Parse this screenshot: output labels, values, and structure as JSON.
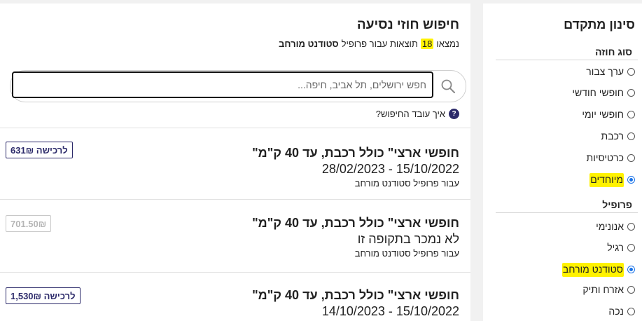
{
  "results": {
    "title": "חיפוש חוזי נסיעה",
    "count_prefix": "נמצאו",
    "count": "18",
    "count_middle": "תוצאות עבור פרופיל",
    "count_profile": "סטודנט מורחב",
    "search": {
      "placeholder": "חפש ירושלים, תל אביב, חיפה...",
      "value": ""
    },
    "help_link": "איך עובד החיפוש?",
    "items": [
      {
        "title": "\"חופשי ארצי\" כולל רכבת, עד 40 ק\"מ",
        "line": "28/02/2023 - 15/10/2022",
        "profile": "עבור פרופיל סטודנט מורחב",
        "price_button": "לרכישה 631₪",
        "purchasable": true
      },
      {
        "title": "\"חופשי ארצי\" כולל רכבת, עד 40 ק\"מ",
        "line": "לא נמכר בתקופה זו",
        "profile": "עבור פרופיל סטודנט מורחב",
        "price_button": "701.50₪",
        "purchasable": false
      },
      {
        "title": "\"חופשי ארצי\" כולל רכבת, עד 40 ק\"מ",
        "line": "14/10/2023 - 15/10/2022",
        "profile": "",
        "price_button": "לרכישה 1,530₪",
        "purchasable": true
      }
    ]
  },
  "filters": {
    "title": "סינון מתקדם",
    "contract_type": {
      "label": "סוג חוזה",
      "options": [
        "ערך צבור",
        "חופשי חודשי",
        "חופשי יומי",
        "רכבת",
        "כרטיסיות",
        "מיוחדים"
      ],
      "selected": "מיוחדים"
    },
    "profile": {
      "label": "פרופיל",
      "options": [
        "אנונימי",
        "רגיל",
        "סטודנט מורחב",
        "אזרח ותיק",
        "נכה"
      ],
      "selected": "סטודנט מורחב"
    }
  },
  "colors": {
    "highlight": "#fff200",
    "brand": "#2c2a6a",
    "radio_selected": "#1a73e8"
  }
}
